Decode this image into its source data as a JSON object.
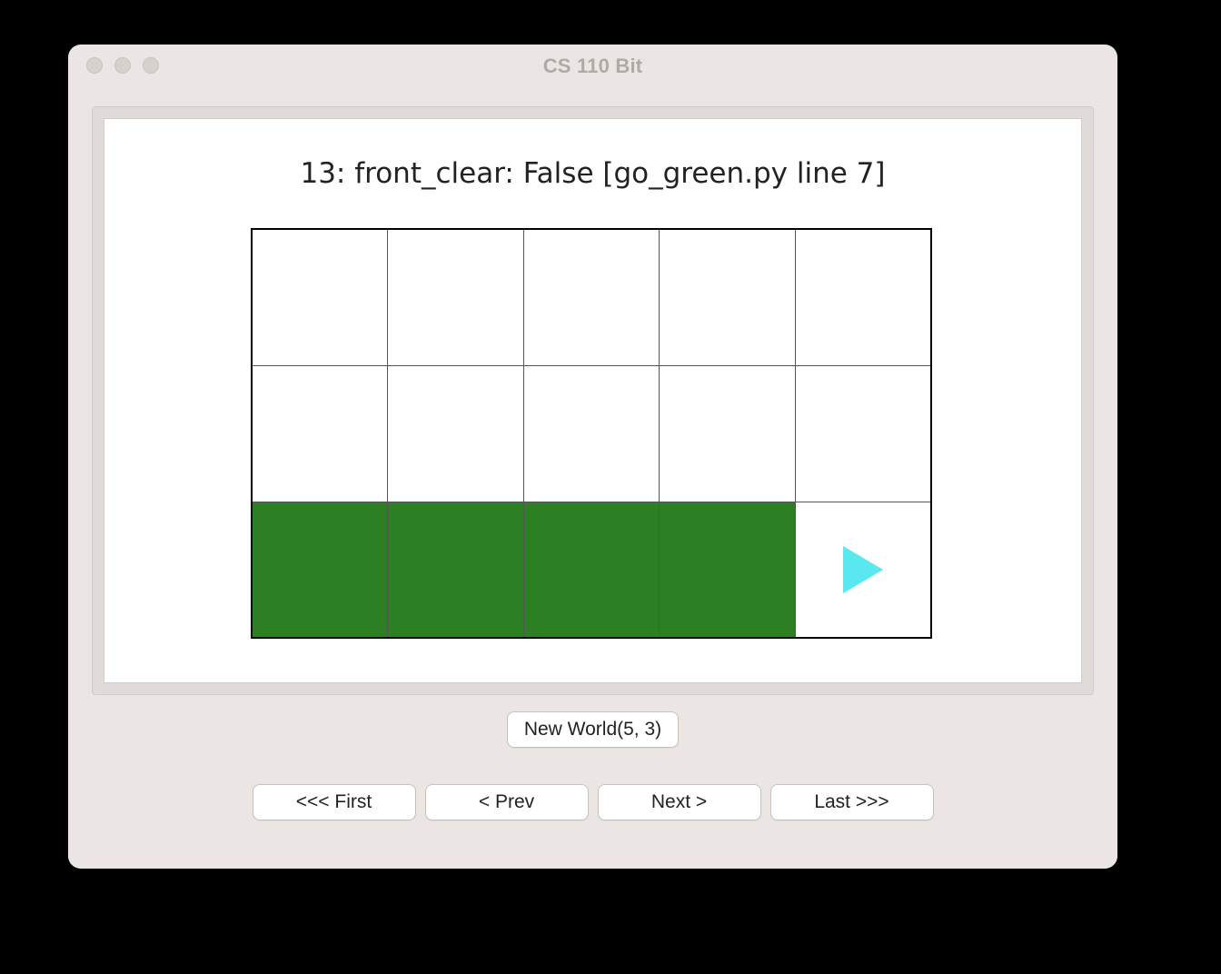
{
  "window": {
    "title": "CS 110 Bit"
  },
  "status": {
    "text": "13: front_clear: False  [go_green.py line 7]"
  },
  "grid": {
    "cols": 5,
    "rows": 3,
    "cells": [
      [
        "white",
        "white",
        "white",
        "white",
        "white"
      ],
      [
        "white",
        "white",
        "white",
        "white",
        "white"
      ],
      [
        "green",
        "green",
        "green",
        "green",
        "white"
      ]
    ],
    "bit": {
      "row": 2,
      "col": 4,
      "facing": "east"
    }
  },
  "buttons": {
    "new_world": "New World(5, 3)",
    "first": "<<< First",
    "prev": "< Prev",
    "next": "Next >",
    "last": "Last >>>"
  }
}
